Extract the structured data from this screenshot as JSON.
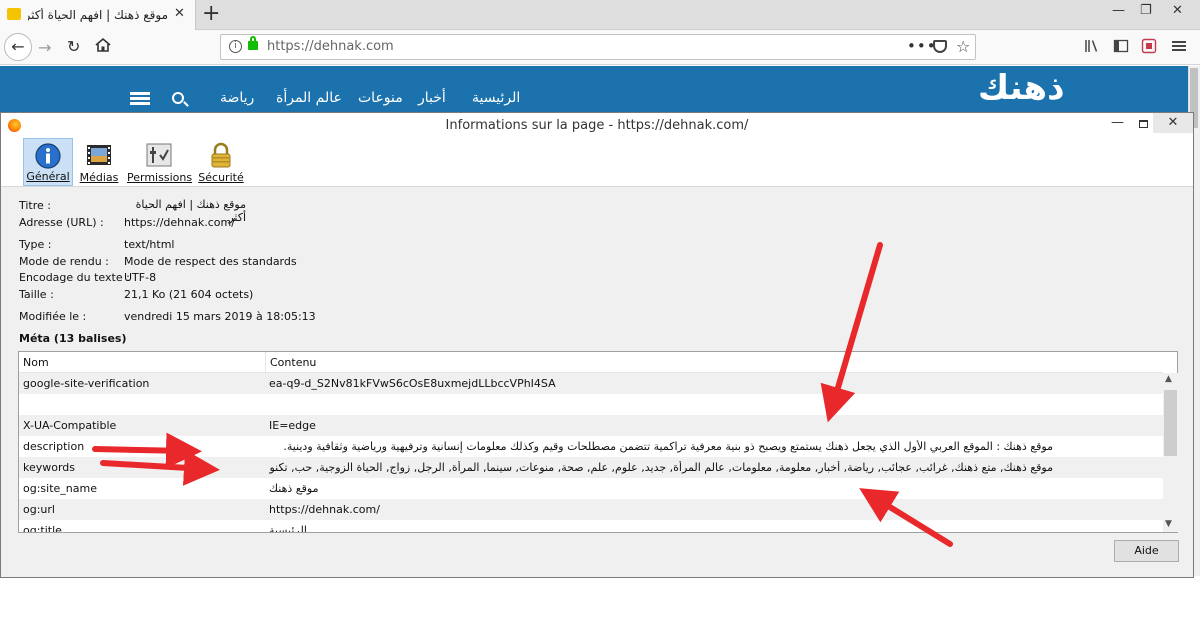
{
  "browser": {
    "tab_title": "موقع ذهنك | افهم الحياة أكثر",
    "tab_close": "✕",
    "new_tab": "+",
    "window_min": "—",
    "window_max": "❐",
    "window_close": "✕",
    "url": "https://dehnak.com",
    "menu_dots": "•••",
    "nav_back": "←",
    "nav_forward": "→",
    "nav_reload": "↻"
  },
  "site": {
    "logo": "ذهنك",
    "nav": [
      "الرئيسية",
      "أخبار",
      "منوعات",
      "عالم المرأة",
      "رياضة"
    ]
  },
  "dialog": {
    "title": "Informations sur la page - https://dehnak.com/",
    "title_min": "—",
    "title_close": "✕",
    "tabs": [
      {
        "label": "Général",
        "icon": "info-icon",
        "selected": true
      },
      {
        "label": "Médias",
        "icon": "film-icon"
      },
      {
        "label": "Permissions",
        "icon": "permissions-icon"
      },
      {
        "label": "Sécurité",
        "icon": "padlock-icon"
      }
    ],
    "fields": [
      {
        "label": "Titre :",
        "value": "موقع ذهنك | افهم الحياة أكثر"
      },
      {
        "label": "Adresse (URL) :",
        "value": "https://dehnak.com/"
      },
      {
        "label": "Type :",
        "value": "text/html"
      },
      {
        "label": "Mode de rendu :",
        "value": "Mode de respect des standards"
      },
      {
        "label": "Encodage du texte :",
        "value": "UTF-8"
      },
      {
        "label": "Taille :",
        "value": "21,1 Ko (21 604 octets)"
      },
      {
        "label": "Modifiée le :",
        "value": "vendredi 15 mars 2019 à 18:05:13"
      }
    ],
    "meta_heading": "Méta (13 balises)",
    "table": {
      "columns": [
        "Nom",
        "Contenu"
      ],
      "rows": [
        {
          "name": "google-site-verification",
          "content": "ea-q9-d_S2Nv81kFVwS6cOsE8uxmejdLLbccVPhI4SA"
        },
        {
          "name": "",
          "content": ""
        },
        {
          "name": "X-UA-Compatible",
          "content": "IE=edge"
        },
        {
          "name": "description",
          "content": "موقع ذهنك : الموقع العربي الأول الذي يجعل ذهنك يستمتع ويصبح ذو بنية معرفية تراكمية تتضمن مصطلحات وقيم وكذلك معلومات إنسانية وترفيهية ورياضية وثقافية ودينية."
        },
        {
          "name": "keywords",
          "content": "موقع ذهنك, متع ذهنك, غرائب, عجائب, رياضة, أخبار, معلومة, معلومات, عالم المرأة, جديد, علوم, علم, صحة, منوعات, سينما, المرأة, الرجل, زواج, الحياة الزوجية, حب, تكنولوجيا, كرة القدم..."
        },
        {
          "name": "og:site_name",
          "content": "موقع ذهنك"
        },
        {
          "name": "og:url",
          "content": "https://dehnak.com/"
        },
        {
          "name": "og:title",
          "content": "الرئيسية"
        }
      ]
    },
    "help_button": "Aide",
    "scroll_up": "▲",
    "scroll_down": "▼"
  },
  "colors": {
    "site_header": "#1b72ad",
    "arrow": "#e8282b",
    "selected_tab": "#cce0f5",
    "secure_lock": "#12bc00"
  }
}
